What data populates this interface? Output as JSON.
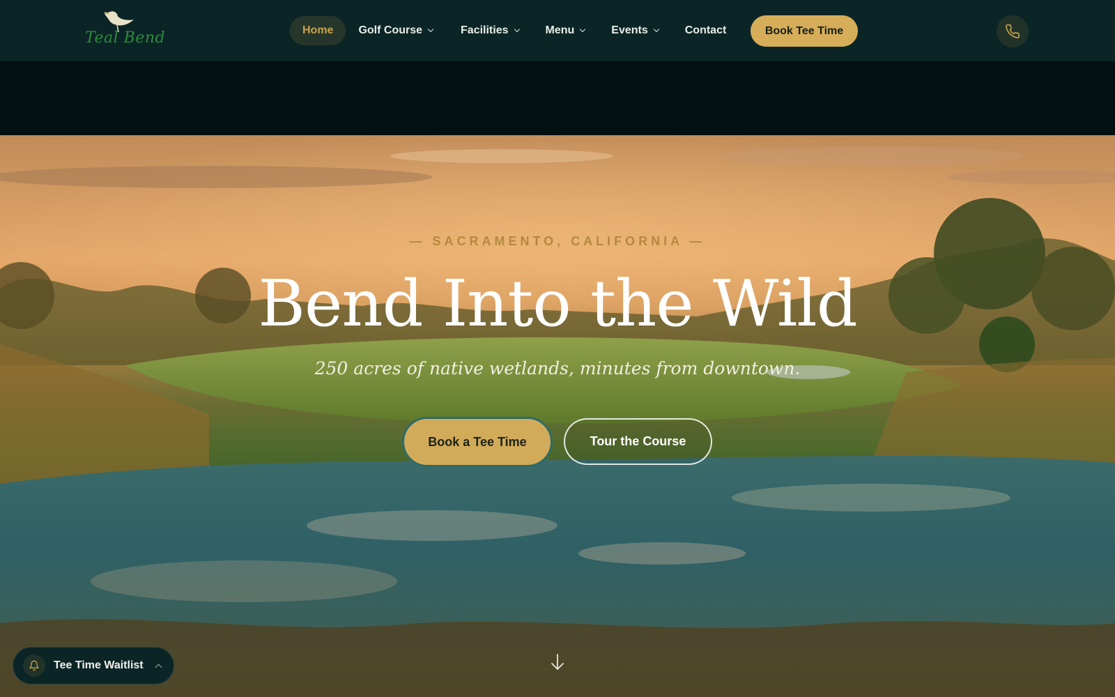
{
  "brand": {
    "logo_text": "Teal Bend",
    "logo_icon": "heron-bird-icon"
  },
  "nav": {
    "items": [
      {
        "label": "Home",
        "active": true,
        "has_dropdown": false
      },
      {
        "label": "Golf Course",
        "active": false,
        "has_dropdown": true
      },
      {
        "label": "Facilities",
        "active": false,
        "has_dropdown": true
      },
      {
        "label": "Menu",
        "active": false,
        "has_dropdown": true
      },
      {
        "label": "Events",
        "active": false,
        "has_dropdown": true
      },
      {
        "label": "Contact",
        "active": false,
        "has_dropdown": false
      }
    ],
    "cta_label": "Book Tee Time",
    "phone_icon": "phone-icon"
  },
  "hero": {
    "eyebrow": "— SACRAMENTO, CALIFORNIA —",
    "headline": "Bend Into the Wild",
    "subhead": "250 acres of native wetlands, minutes from downtown.",
    "primary_button": "Book a Tee Time",
    "secondary_button": "Tour the Course",
    "scroll_icon": "arrow-down-icon"
  },
  "waitlist": {
    "label": "Tee Time Waitlist",
    "icon": "bell-icon"
  },
  "colors": {
    "nav_bg": "#0b2526",
    "accent_gold": "#d6ad58",
    "eyebrow_gold": "#b5893e",
    "dark_band": "#031012"
  }
}
